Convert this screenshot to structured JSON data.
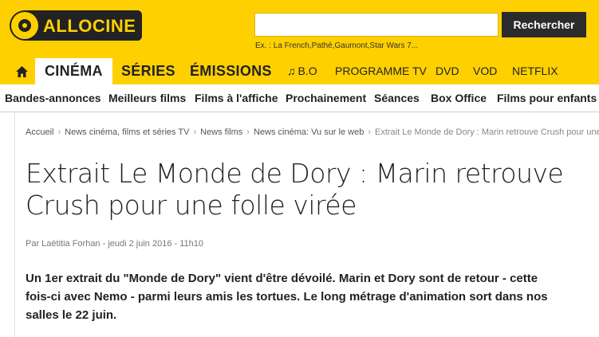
{
  "brand": {
    "logo_text": "ALLOCINE"
  },
  "search": {
    "value": "",
    "placeholder": "",
    "button_label": "Rechercher",
    "examples": "Ex. : La French,Pathé,Gaumont,Star Wars 7..."
  },
  "nav": {
    "home_icon": "home-icon",
    "items": [
      {
        "label": "CINÉMA",
        "active": true
      },
      {
        "label": "SÉRIES"
      },
      {
        "label": "ÉMISSIONS"
      },
      {
        "label": "B.O",
        "icon": "music-note-icon"
      },
      {
        "label": "PROGRAMME TV"
      },
      {
        "label": "DVD"
      },
      {
        "label": "VOD"
      },
      {
        "label": "NETFLIX"
      }
    ]
  },
  "subnav": {
    "items": [
      {
        "label": "Bandes-annonces"
      },
      {
        "label": "Meilleurs films"
      },
      {
        "label": "Films à l'affiche"
      },
      {
        "label": "Prochainement"
      },
      {
        "label": "Séances"
      },
      {
        "label": "Box Office"
      },
      {
        "label": "Films pour enfants"
      }
    ]
  },
  "breadcrumb": {
    "items": [
      {
        "label": "Accueil"
      },
      {
        "label": "News cinéma, films et séries TV"
      },
      {
        "label": "News films"
      },
      {
        "label": "News cinéma: Vu sur le web"
      },
      {
        "label": "Extrait Le Monde de Dory : Marin retrouve Crush pour une folle virée"
      }
    ]
  },
  "article": {
    "title": "Extrait Le Monde de Dory : Marin retrouve Crush pour une folle virée",
    "byline": "Par Laëtitia Forhan - jeudi 2 juin 2016 - 11h10",
    "lead": "Un 1er extrait du \"Monde de Dory\" vient d'être dévoilé. Marin et Dory sont de retour - cette fois-ci avec Nemo - parmi leurs amis les tortues. Le long métrage d'animation sort dans nos salles le 22 juin."
  },
  "colors": {
    "brand_yellow": "#ffd000",
    "dark": "#222222"
  }
}
